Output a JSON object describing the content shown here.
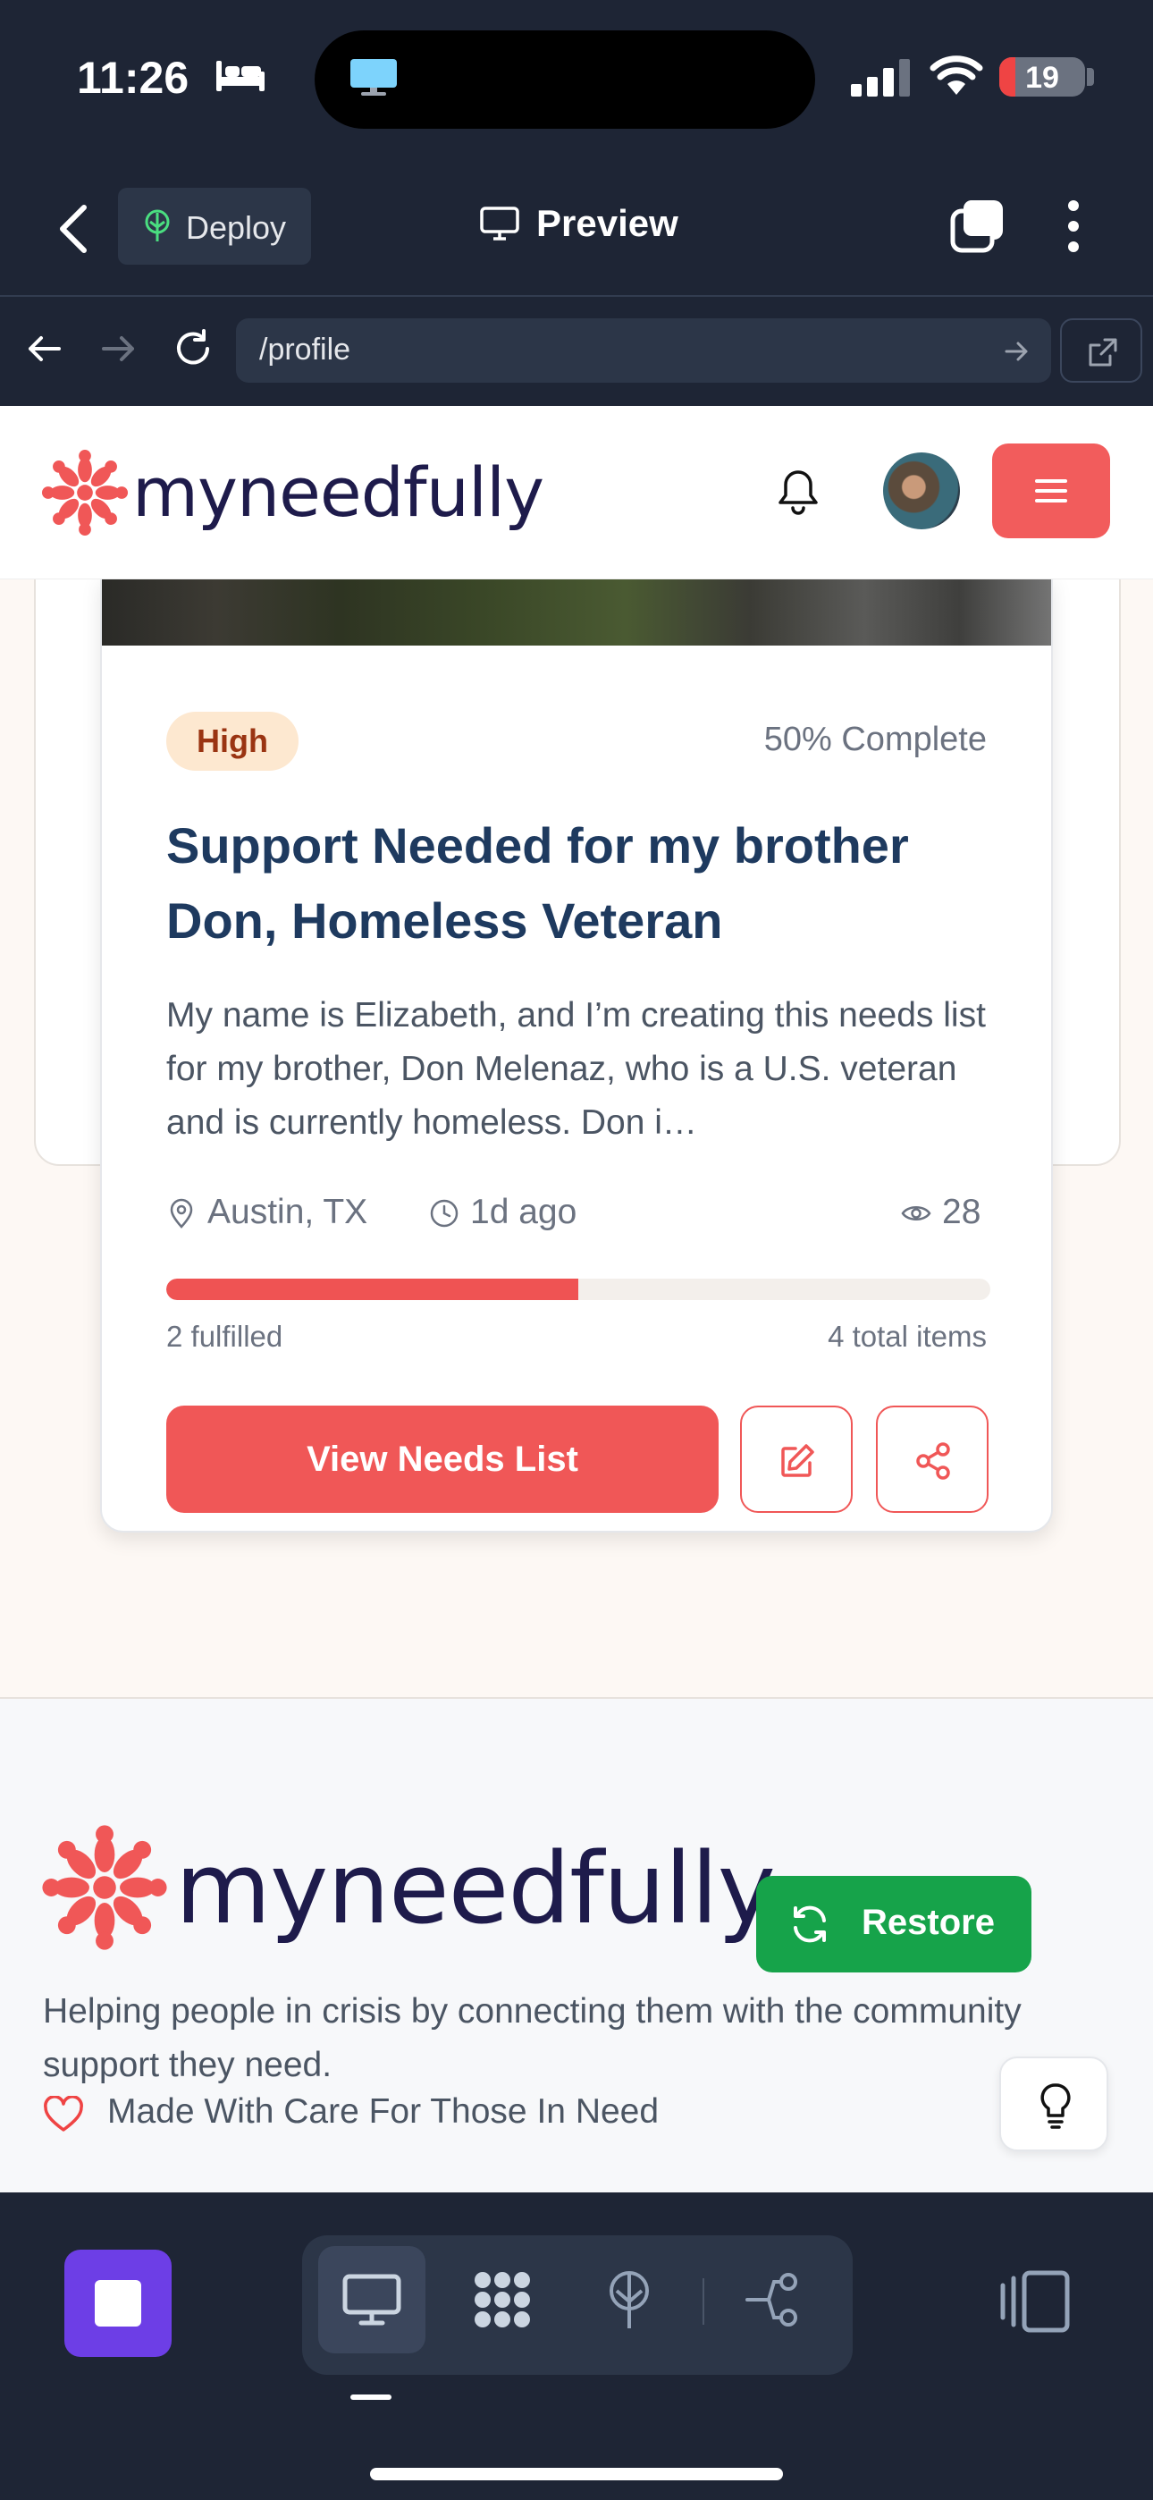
{
  "status_bar": {
    "time": "11:26",
    "battery": "19",
    "battery_level": 0.19
  },
  "top_nav": {
    "deploy_label": "Deploy",
    "preview_label": "Preview"
  },
  "url_bar": {
    "url": "/profile"
  },
  "site": {
    "logo_text": "myneedfully"
  },
  "need_card": {
    "priority": "High",
    "completion": "50% Complete",
    "completion_fraction": 0.5,
    "title": "Support Needed for my brother Don, Homeless Veteran",
    "description": "My name is Elizabeth, and I’m creating this needs list for my brother, Don Melenaz, who is a U.S. veteran and is currently homeless. Don i…",
    "location": "Austin, TX",
    "posted": "1d ago",
    "views": "28",
    "fulfilled": "2 fulfilled",
    "total_items": "4 total items",
    "view_button": "View Needs List"
  },
  "restore_button": "Restore",
  "footer": {
    "logo_text": "myneedfully",
    "tagline": "Helping people in crisis by connecting them with the community support they need.",
    "made_with": "Made With Care For Those In Need"
  },
  "colors": {
    "brand_coral": "#f05757",
    "navy": "#1e3a5f",
    "success_green": "#16a34a",
    "chrome_bg": "#1e2535",
    "stop_purple": "#6d3ee6"
  },
  "icons": [
    "bed-icon",
    "monitor-icon",
    "signal-icon",
    "wifi-icon",
    "battery-icon",
    "back-chevron-icon",
    "deploy-icon",
    "preview-monitor-icon",
    "tabs-icon",
    "more-icon",
    "arrow-left-icon",
    "arrow-right-icon",
    "reload-icon",
    "go-arrow-icon",
    "external-link-icon",
    "logo-mark-icon",
    "bell-icon",
    "menu-icon",
    "location-pin-icon",
    "clock-icon",
    "eye-icon",
    "edit-icon",
    "share-icon",
    "refresh-icon",
    "heart-icon",
    "lightbulb-icon",
    "stop-icon",
    "desktop-icon",
    "grid-icon",
    "deploy-tree-icon",
    "git-icon",
    "panels-icon"
  ]
}
